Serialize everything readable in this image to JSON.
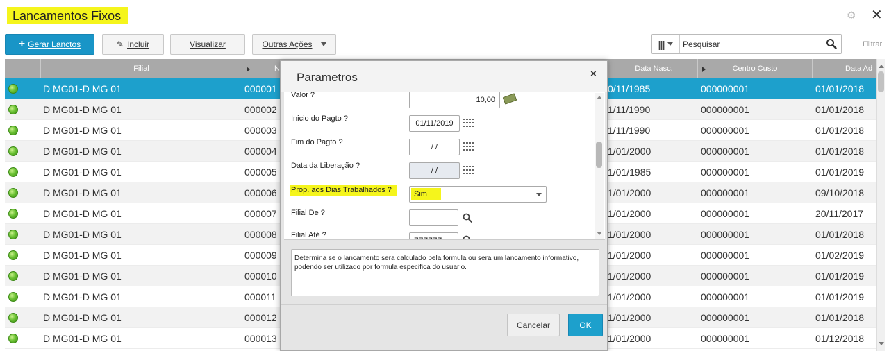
{
  "header": {
    "title": "Lancamentos Fixos",
    "gear_icon": "gear-icon",
    "close_icon": "close-icon"
  },
  "toolbar": {
    "gerar_label": "Gerar Lanctos",
    "incluir_label": "Incluir",
    "visualizar_label": "Visualizar",
    "outras_label": "Outras Ações",
    "search_placeholder": "Pesquisar",
    "filter_label": "Filtrar"
  },
  "colors": {
    "accent": "#1da0cc",
    "highlight": "#f5f51c",
    "header_gray": "#a9a9a9",
    "status_green": "#6cc234"
  },
  "table": {
    "columns": [
      "Filial",
      "N",
      "Data Nasc.",
      "Centro Custo",
      "Data Ad"
    ],
    "rows": [
      {
        "filial": "D MG01-D MG 01",
        "num": "000001",
        "nasc": "0/11/1985",
        "cc": "000000001",
        "adm": "01/01/2018",
        "selected": true
      },
      {
        "filial": "D MG01-D MG 01",
        "num": "000002",
        "nasc": "1/11/1990",
        "cc": "000000001",
        "adm": "01/01/2018"
      },
      {
        "filial": "D MG01-D MG 01",
        "num": "000003",
        "nasc": "1/11/1990",
        "cc": "000000001",
        "adm": "01/01/2018"
      },
      {
        "filial": "D MG01-D MG 01",
        "num": "000004",
        "nasc": "1/01/2000",
        "cc": "000000001",
        "adm": "01/01/2018"
      },
      {
        "filial": "D MG01-D MG 01",
        "num": "000005",
        "nasc": "1/01/1985",
        "cc": "000000001",
        "adm": "01/01/2019"
      },
      {
        "filial": "D MG01-D MG 01",
        "num": "000006",
        "nasc": "1/01/2000",
        "cc": "000000001",
        "adm": "09/10/2018"
      },
      {
        "filial": "D MG01-D MG 01",
        "num": "000007",
        "nasc": "1/01/2000",
        "cc": "000000001",
        "adm": "20/11/2017"
      },
      {
        "filial": "D MG01-D MG 01",
        "num": "000008",
        "nasc": "1/01/2000",
        "cc": "000000001",
        "adm": "01/01/2018"
      },
      {
        "filial": "D MG01-D MG 01",
        "num": "000009",
        "nasc": "1/01/2000",
        "cc": "000000001",
        "adm": "01/02/2019"
      },
      {
        "filial": "D MG01-D MG 01",
        "num": "000010",
        "nasc": "1/01/2000",
        "cc": "000000001",
        "adm": "01/01/2019"
      },
      {
        "filial": "D MG01-D MG 01",
        "num": "000011",
        "nasc": "1/01/2000",
        "cc": "000000001",
        "adm": "01/01/2019"
      },
      {
        "filial": "D MG01-D MG 01",
        "num": "000012",
        "nasc": "1/01/2000",
        "cc": "000000001",
        "adm": "01/01/2018"
      },
      {
        "filial": "D MG01-D MG 01",
        "num": "000013",
        "nasc": "1/01/2000",
        "cc": "000000001",
        "adm": "01/12/2018"
      }
    ]
  },
  "modal": {
    "title": "Parametros",
    "fields": {
      "valor_label": "Valor ?",
      "valor_value": "10,00",
      "inicio_label": "Inicio do Pagto ?",
      "inicio_value": "01/11/2019",
      "fim_label": "Fim do Pagto ?",
      "fim_value": "/ /",
      "liberacao_label": "Data da Liberação ?",
      "liberacao_value": "/ /",
      "prop_label": "Prop. aos Dias Trabalhados ?",
      "prop_value": "Sim",
      "filial_de_label": "Filial De ?",
      "filial_de_value": "",
      "filial_ate_label": "Filial Até ?",
      "filial_ate_value": "ZZZZZZ"
    },
    "help_text": "Determina se o lancamento sera calculado pela formula ou sera um lancamento informativo, podendo ser utilizado por formula especifica do usuario.",
    "cancel_label": "Cancelar",
    "ok_label": "OK"
  }
}
